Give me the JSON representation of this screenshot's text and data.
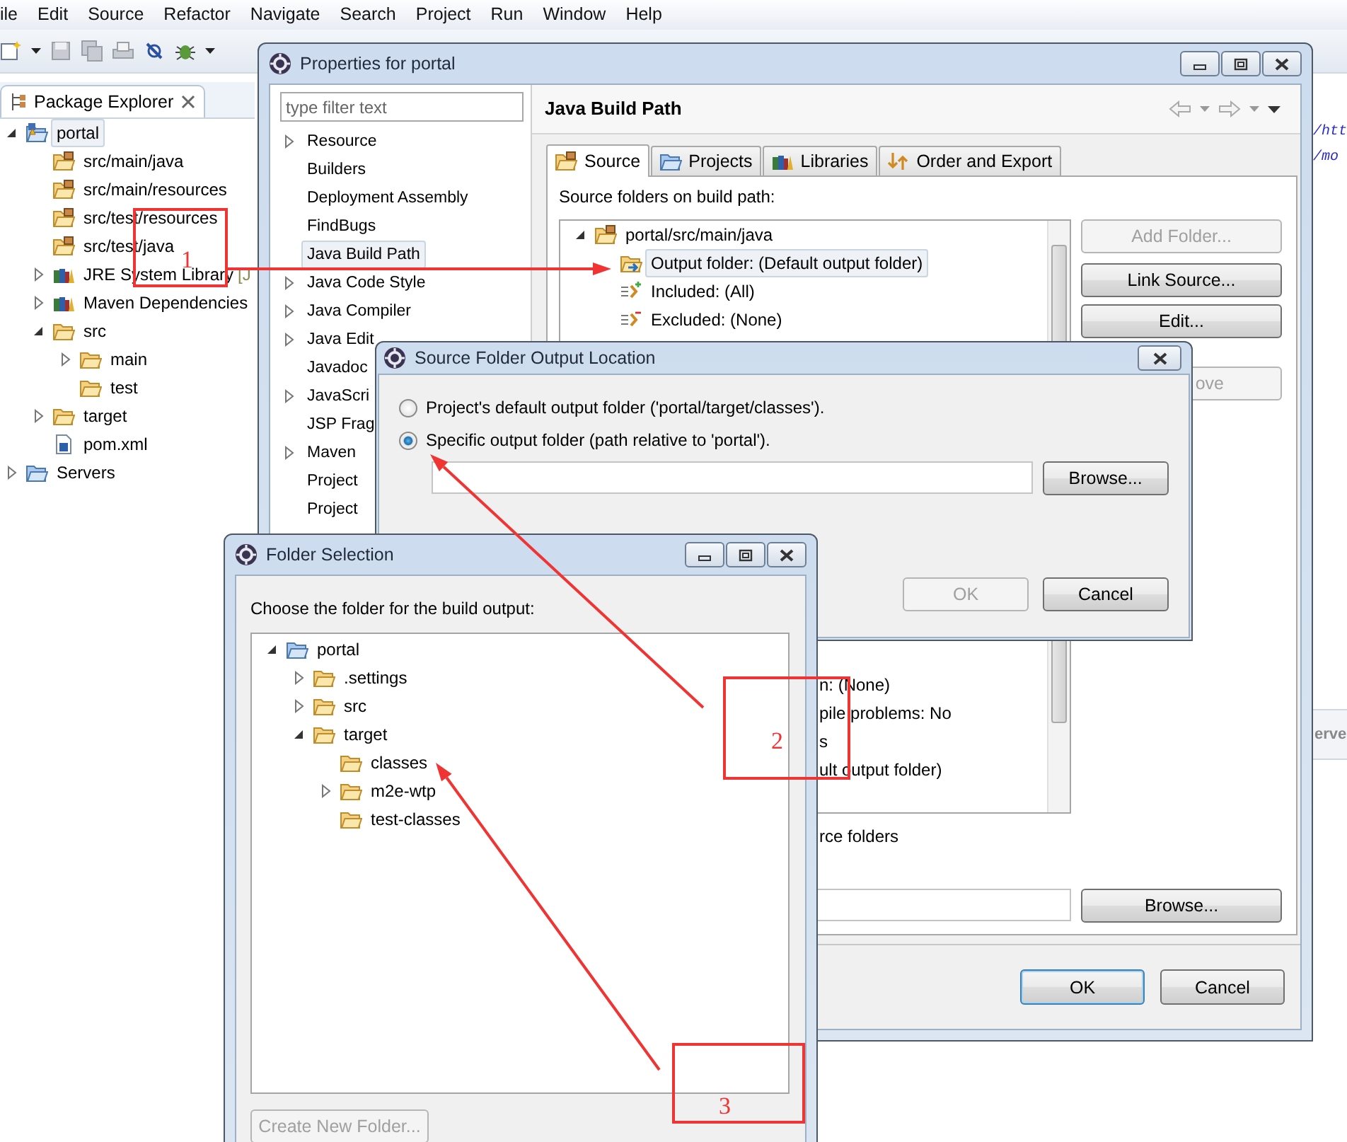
{
  "menu_bar": [
    "ile",
    "Edit",
    "Source",
    "Refactor",
    "Navigate",
    "Search",
    "Project",
    "Run",
    "Window",
    "Help"
  ],
  "package_explorer": {
    "title": "Package Explorer",
    "tree": [
      {
        "label": "portal",
        "kind": "project",
        "expanded": true,
        "selected": true,
        "children": [
          {
            "label": "src/main/java",
            "kind": "source-folder",
            "selected": false
          },
          {
            "label": "src/main/resources",
            "kind": "source-folder",
            "selected": false
          },
          {
            "label": "src/test/resources",
            "kind": "source-folder",
            "selected": false
          },
          {
            "label": "src/test/java",
            "kind": "source-folder",
            "selected": false
          },
          {
            "label": "JRE System Library",
            "decoration": "[J",
            "kind": "library",
            "expanded": false,
            "selected": false
          },
          {
            "label": "Maven Dependencies",
            "kind": "library",
            "expanded": false,
            "selected": false
          },
          {
            "label": "src",
            "kind": "folder",
            "expanded": true,
            "selected": false,
            "children": [
              {
                "label": "main",
                "kind": "folder",
                "expanded": false,
                "selected": false
              },
              {
                "label": "test",
                "kind": "folder",
                "selected": false
              }
            ]
          },
          {
            "label": "target",
            "kind": "folder",
            "expanded": false,
            "selected": false
          },
          {
            "label": "pom.xml",
            "kind": "pom",
            "selected": false
          }
        ]
      },
      {
        "label": "Servers",
        "kind": "servers",
        "expanded": false,
        "selected": false
      }
    ]
  },
  "editor_fragments": [
    "/htt",
    "/mo"
  ],
  "servers_tab_fragment": "erve",
  "properties_dialog": {
    "title": "Properties for portal",
    "filter_placeholder": "type filter text",
    "pages": [
      {
        "label": "Resource",
        "expanded": false,
        "selected": false
      },
      {
        "label": "Builders",
        "selected": false
      },
      {
        "label": "Deployment Assembly",
        "selected": false
      },
      {
        "label": "FindBugs",
        "selected": false
      },
      {
        "label": "Java Build Path",
        "selected": true
      },
      {
        "label": "Java Code Style",
        "expanded": false,
        "selected": false
      },
      {
        "label": "Java Compiler",
        "expanded": false,
        "selected": false
      },
      {
        "label": "Java Edit",
        "expanded": false,
        "selected": false
      },
      {
        "label": "Javadoc",
        "selected": false
      },
      {
        "label": "JavaScri",
        "expanded": false,
        "selected": false
      },
      {
        "label": "JSP Frag",
        "selected": false
      },
      {
        "label": "Maven",
        "expanded": false,
        "selected": false
      },
      {
        "label": "Project",
        "selected": false
      },
      {
        "label": "Project",
        "selected": false
      }
    ],
    "page_title": "Java Build Path",
    "tabs": [
      {
        "label": "Source",
        "kind": "source",
        "selected": true
      },
      {
        "label": "Projects",
        "kind": "projects",
        "selected": false
      },
      {
        "label": "Libraries",
        "kind": "libraries",
        "selected": false
      },
      {
        "label": "Order and Export",
        "kind": "order",
        "selected": false
      }
    ],
    "source_label": "Source folders on build path:",
    "source_tree": [
      {
        "label": "portal/src/main/java",
        "kind": "source-folder",
        "expanded": true,
        "selected": false,
        "children": [
          {
            "label": "Output folder: (Default output folder)",
            "kind": "output",
            "selected": true
          },
          {
            "label": "Included: (All)",
            "kind": "included",
            "selected": false
          },
          {
            "label": "Excluded: (None)",
            "kind": "excluded",
            "selected": false
          }
        ]
      }
    ],
    "partial_rows": [
      "n: (None)",
      "pile problems: No",
      "s",
      "ult output folder)"
    ],
    "side_buttons": [
      {
        "label": "Add Folder...",
        "disabled": true
      },
      {
        "label": "Link Source...",
        "disabled": false
      },
      {
        "label": "Edit...",
        "disabled": false
      },
      {
        "label": "ove",
        "disabled": true
      }
    ],
    "allow_label": "rce folders",
    "browse_label": "Browse...",
    "buttons": [
      {
        "label": "OK",
        "default": true
      },
      {
        "label": "Cancel",
        "default": false
      }
    ]
  },
  "output_location_dialog": {
    "title": "Source Folder Output Location",
    "options": [
      {
        "label": "Project's default output folder ('portal/target/classes').",
        "selected": false
      },
      {
        "label": "Specific output folder (path relative to 'portal').",
        "selected": true
      }
    ],
    "browse_label": "Browse...",
    "buttons": [
      {
        "label": "OK",
        "disabled": true
      },
      {
        "label": "Cancel",
        "disabled": false
      }
    ]
  },
  "folder_selection_dialog": {
    "title": "Folder Selection",
    "prompt": "Choose the folder for the build output:",
    "tree": [
      {
        "label": "portal",
        "kind": "project-folder",
        "expanded": true,
        "selected": false,
        "children": [
          {
            "label": ".settings",
            "kind": "folder",
            "expanded": false,
            "selected": false
          },
          {
            "label": "src",
            "kind": "folder",
            "expanded": false,
            "selected": false
          },
          {
            "label": "target",
            "kind": "folder",
            "expanded": true,
            "selected": false,
            "children": [
              {
                "label": "classes",
                "kind": "folder",
                "selected": false
              },
              {
                "label": "m2e-wtp",
                "kind": "folder",
                "expanded": false,
                "selected": false
              },
              {
                "label": "test-classes",
                "kind": "folder",
                "selected": false
              }
            ]
          }
        ]
      }
    ],
    "create_button": {
      "label": "Create New Folder...",
      "disabled": true
    }
  },
  "annotations": [
    {
      "number": "1"
    },
    {
      "number": "2"
    },
    {
      "number": "3"
    }
  ]
}
